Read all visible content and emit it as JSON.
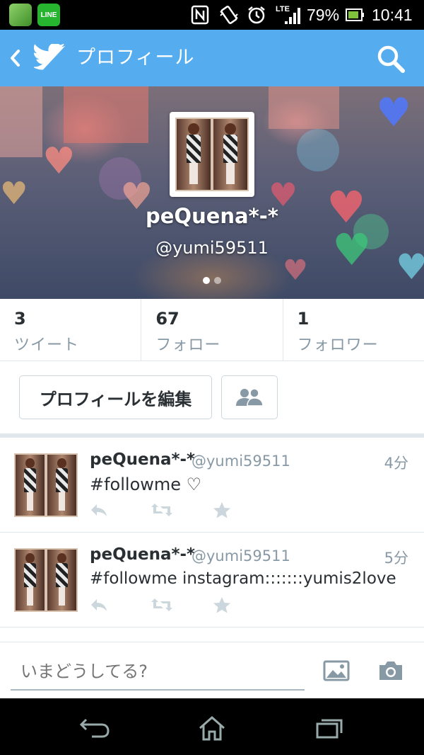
{
  "status_bar": {
    "battery_percent": "79%",
    "time": "10:41",
    "network": "LTE",
    "apps": [
      "line-app-icon"
    ],
    "line_label": "LINE"
  },
  "toolbar": {
    "title": "プロフィール"
  },
  "profile": {
    "name": "peQuena*-*",
    "handle": "@yumi59511"
  },
  "stats": [
    {
      "count": "3",
      "label": "ツイート"
    },
    {
      "count": "67",
      "label": "フォロー"
    },
    {
      "count": "1",
      "label": "フォロワー"
    }
  ],
  "actions": {
    "edit_profile": "プロフィールを編集"
  },
  "tweets": [
    {
      "name": "peQuena*-*",
      "handle": "@yumi59511",
      "time": "4分",
      "text": "#followme ♡"
    },
    {
      "name": "peQuena*-*",
      "handle": "@yumi59511",
      "time": "5分",
      "text": "#followme instagram:::::::yumis2love"
    }
  ],
  "composer": {
    "placeholder": "いまどうしてる?"
  },
  "colors": {
    "accent": "#55acee",
    "muted": "#8899a6",
    "text": "#292f33"
  }
}
